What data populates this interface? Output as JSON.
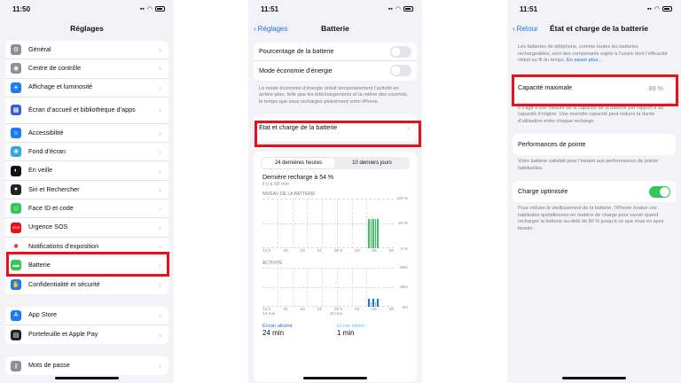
{
  "panel1": {
    "time": "11:50",
    "title": "Réglages",
    "group1": [
      {
        "label": "Général",
        "icon": "gear-icon",
        "color": "#8e8e93"
      },
      {
        "label": "Centre de contrôle",
        "icon": "control-center-icon",
        "color": "#8e8e93"
      },
      {
        "label": "Affichage et luminosité",
        "icon": "sun-icon",
        "color": "#1a7cf5"
      },
      {
        "label": "Écran d’accueil et bibliothèque d’apps",
        "icon": "home-grid-icon",
        "color": "#3b5bdb"
      },
      {
        "label": "Accessibilité",
        "icon": "accessibility-icon",
        "color": "#1a7cf5"
      },
      {
        "label": "Fond d’écran",
        "icon": "wallpaper-icon",
        "color": "#34aadc"
      },
      {
        "label": "En veille",
        "icon": "standby-icon",
        "color": "#111111"
      },
      {
        "label": "Siri et Rechercher",
        "icon": "siri-icon",
        "color": "#222222"
      },
      {
        "label": "Face ID et code",
        "icon": "face-id-icon",
        "color": "#34c759"
      },
      {
        "label": "Urgence SOS",
        "icon": "sos-icon",
        "color": "#e8101a"
      },
      {
        "label": "Notifications d’exposition",
        "icon": "exposure-icon",
        "color": "#ffffff"
      },
      {
        "label": "Batterie",
        "icon": "battery-icon",
        "color": "#34c759"
      },
      {
        "label": "Confidentialité et sécurité",
        "icon": "hand-icon",
        "color": "#1a7cf5"
      }
    ],
    "group2": [
      {
        "label": "App Store",
        "icon": "app-store-icon",
        "color": "#1a7cf5"
      },
      {
        "label": "Portefeuille et Apple Pay",
        "icon": "wallet-icon",
        "color": "#222222"
      }
    ],
    "group3": [
      {
        "label": "Mots de passe",
        "icon": "key-icon",
        "color": "#8e8e93"
      }
    ]
  },
  "panel2": {
    "time": "11:51",
    "back": "Réglages",
    "title": "Batterie",
    "rows": [
      "Pourcentage de la batterie",
      "Mode économie d’énergie"
    ],
    "note": "Le mode économie d’énergie réduit temporairement l’activité en arrière-plan, telle que les téléchargements et la relève des courriels, le temps que vous rechargez pleinement votre iPhone.",
    "health_row": "État et charge de la batterie",
    "seg": [
      "24 dernières heures",
      "10 derniers jours"
    ],
    "last_charge": "Dernière recharge à 54 %",
    "last_charge_time": "il y a 58 min",
    "chart1_label": "NIVEAU DE LA BATTERIE",
    "chart1_yticks": [
      "100 %",
      "50 %",
      "0 %"
    ],
    "chart2_label": "ACTIVITÉ",
    "chart2_yticks": [
      "60m",
      "30m",
      "0m"
    ],
    "xticks": [
      "12 h",
      "15",
      "18",
      "21",
      "00 h",
      "03",
      "06",
      "09"
    ],
    "xdates": [
      "14 mai",
      "15 mai"
    ],
    "screen_on_label": "Écran allumé",
    "screen_on_value": "24 min",
    "screen_off_label": "Écran éteint",
    "screen_off_value": "1 min"
  },
  "chart_data": [
    {
      "type": "bar",
      "title": "NIVEAU DE LA BATTERIE",
      "categories": [
        "12 h",
        "15",
        "18",
        "21",
        "00 h",
        "03",
        "06",
        "09"
      ],
      "values": [
        0,
        0,
        0,
        0,
        0,
        0,
        0,
        60
      ],
      "ylim": [
        0,
        100
      ]
    },
    {
      "type": "bar",
      "title": "ACTIVITÉ",
      "categories": [
        "12 h",
        "15",
        "18",
        "21",
        "00 h",
        "03",
        "06",
        "09"
      ],
      "values": [
        0,
        0,
        0,
        0,
        0,
        0,
        0,
        12
      ],
      "ylim": [
        0,
        60
      ]
    }
  ],
  "panel3": {
    "time": "11:51",
    "back": "Retour",
    "title": "État et charge de la batterie",
    "intro": "Les batteries de téléphone, comme toutes les batteries rechargeables, sont des composants sujets à l’usure dont l’efficacité réduit au fil du temps.",
    "intro_link": "En savoir plus…",
    "capacity_label": "Capacité maximale",
    "capacity_value": "89 %",
    "capacity_note": "Il s’agit d’une mesure de la capacité de la batterie par rapport à sa capacité d’origine. Une moindre capacité peut réduire la durée d’utilisation entre chaque recharge.",
    "peak_label": "Performances de pointe",
    "peak_note": "Votre batterie satisfait pour l’instant aux performances de pointe habituelles.",
    "optimized_label": "Charge optimisée",
    "optimized_note": "Pour réduire le vieillissement de la batterie, l’iPhone évalue vos habitudes quotidiennes en matière de charge pour savoir quand recharger la batterie au-delà de 80 % jusqu’à ce que vous en ayez besoin."
  }
}
